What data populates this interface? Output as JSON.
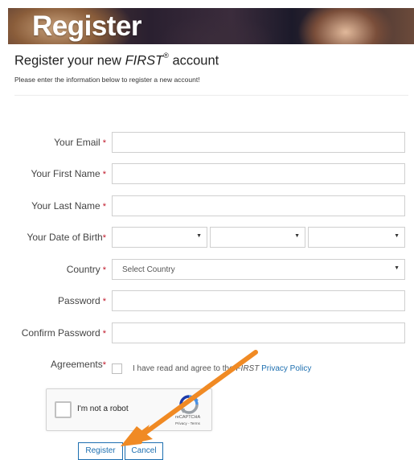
{
  "banner": {
    "title": "Register"
  },
  "heading": {
    "prefix": "Register your new ",
    "brand": "FIRST",
    "registered_mark": "®",
    "suffix": " account"
  },
  "subtitle": "Please enter the information below to register a new account!",
  "form": {
    "required_marker": "*",
    "email": {
      "label": "Your Email",
      "value": ""
    },
    "first_name": {
      "label": "Your First Name",
      "value": ""
    },
    "last_name": {
      "label": "Your Last Name",
      "value": ""
    },
    "dob": {
      "label": "Your Date of Birth",
      "month": "",
      "day": "",
      "year": ""
    },
    "country": {
      "label": "Country",
      "selected": "Select Country"
    },
    "password": {
      "label": "Password",
      "value": ""
    },
    "confirm_password": {
      "label": "Confirm Password",
      "value": ""
    },
    "agreements": {
      "label": "Agreements",
      "text_prefix": "I have read and agree to the ",
      "brand": "FIRST",
      "link": "Privacy Policy"
    }
  },
  "captcha": {
    "label": "I'm not a robot",
    "brand": "reCAPTCHA",
    "terms": "Privacy - Terms"
  },
  "buttons": {
    "register": "Register",
    "cancel": "Cancel"
  },
  "colors": {
    "required": "#c0182a",
    "link": "#1d6fb0",
    "annotation_arrow": "#f08a24"
  }
}
